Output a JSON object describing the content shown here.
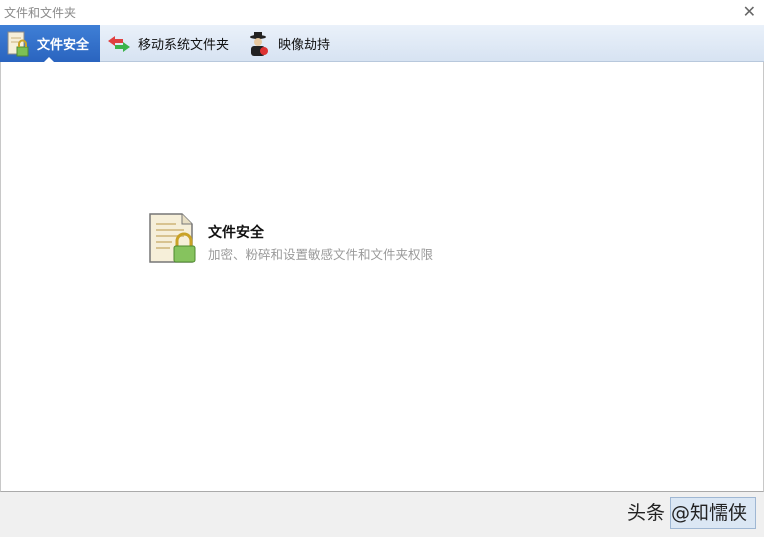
{
  "window": {
    "title": "文件和文件夹",
    "close_icon": "close-icon"
  },
  "tabs": [
    {
      "label": "文件安全",
      "icon": "file-lock-icon",
      "active": true
    },
    {
      "label": "移动系统文件夹",
      "icon": "move-arrows-icon",
      "active": false
    },
    {
      "label": "映像劫持",
      "icon": "hijacker-icon",
      "active": false
    }
  ],
  "main": {
    "item": {
      "title": "文件安全",
      "description": "加密、粉碎和设置敏感文件和文件夹权限",
      "icon": "file-lock-icon"
    }
  },
  "footer": {
    "watermark": "头条 @知懦侠"
  }
}
